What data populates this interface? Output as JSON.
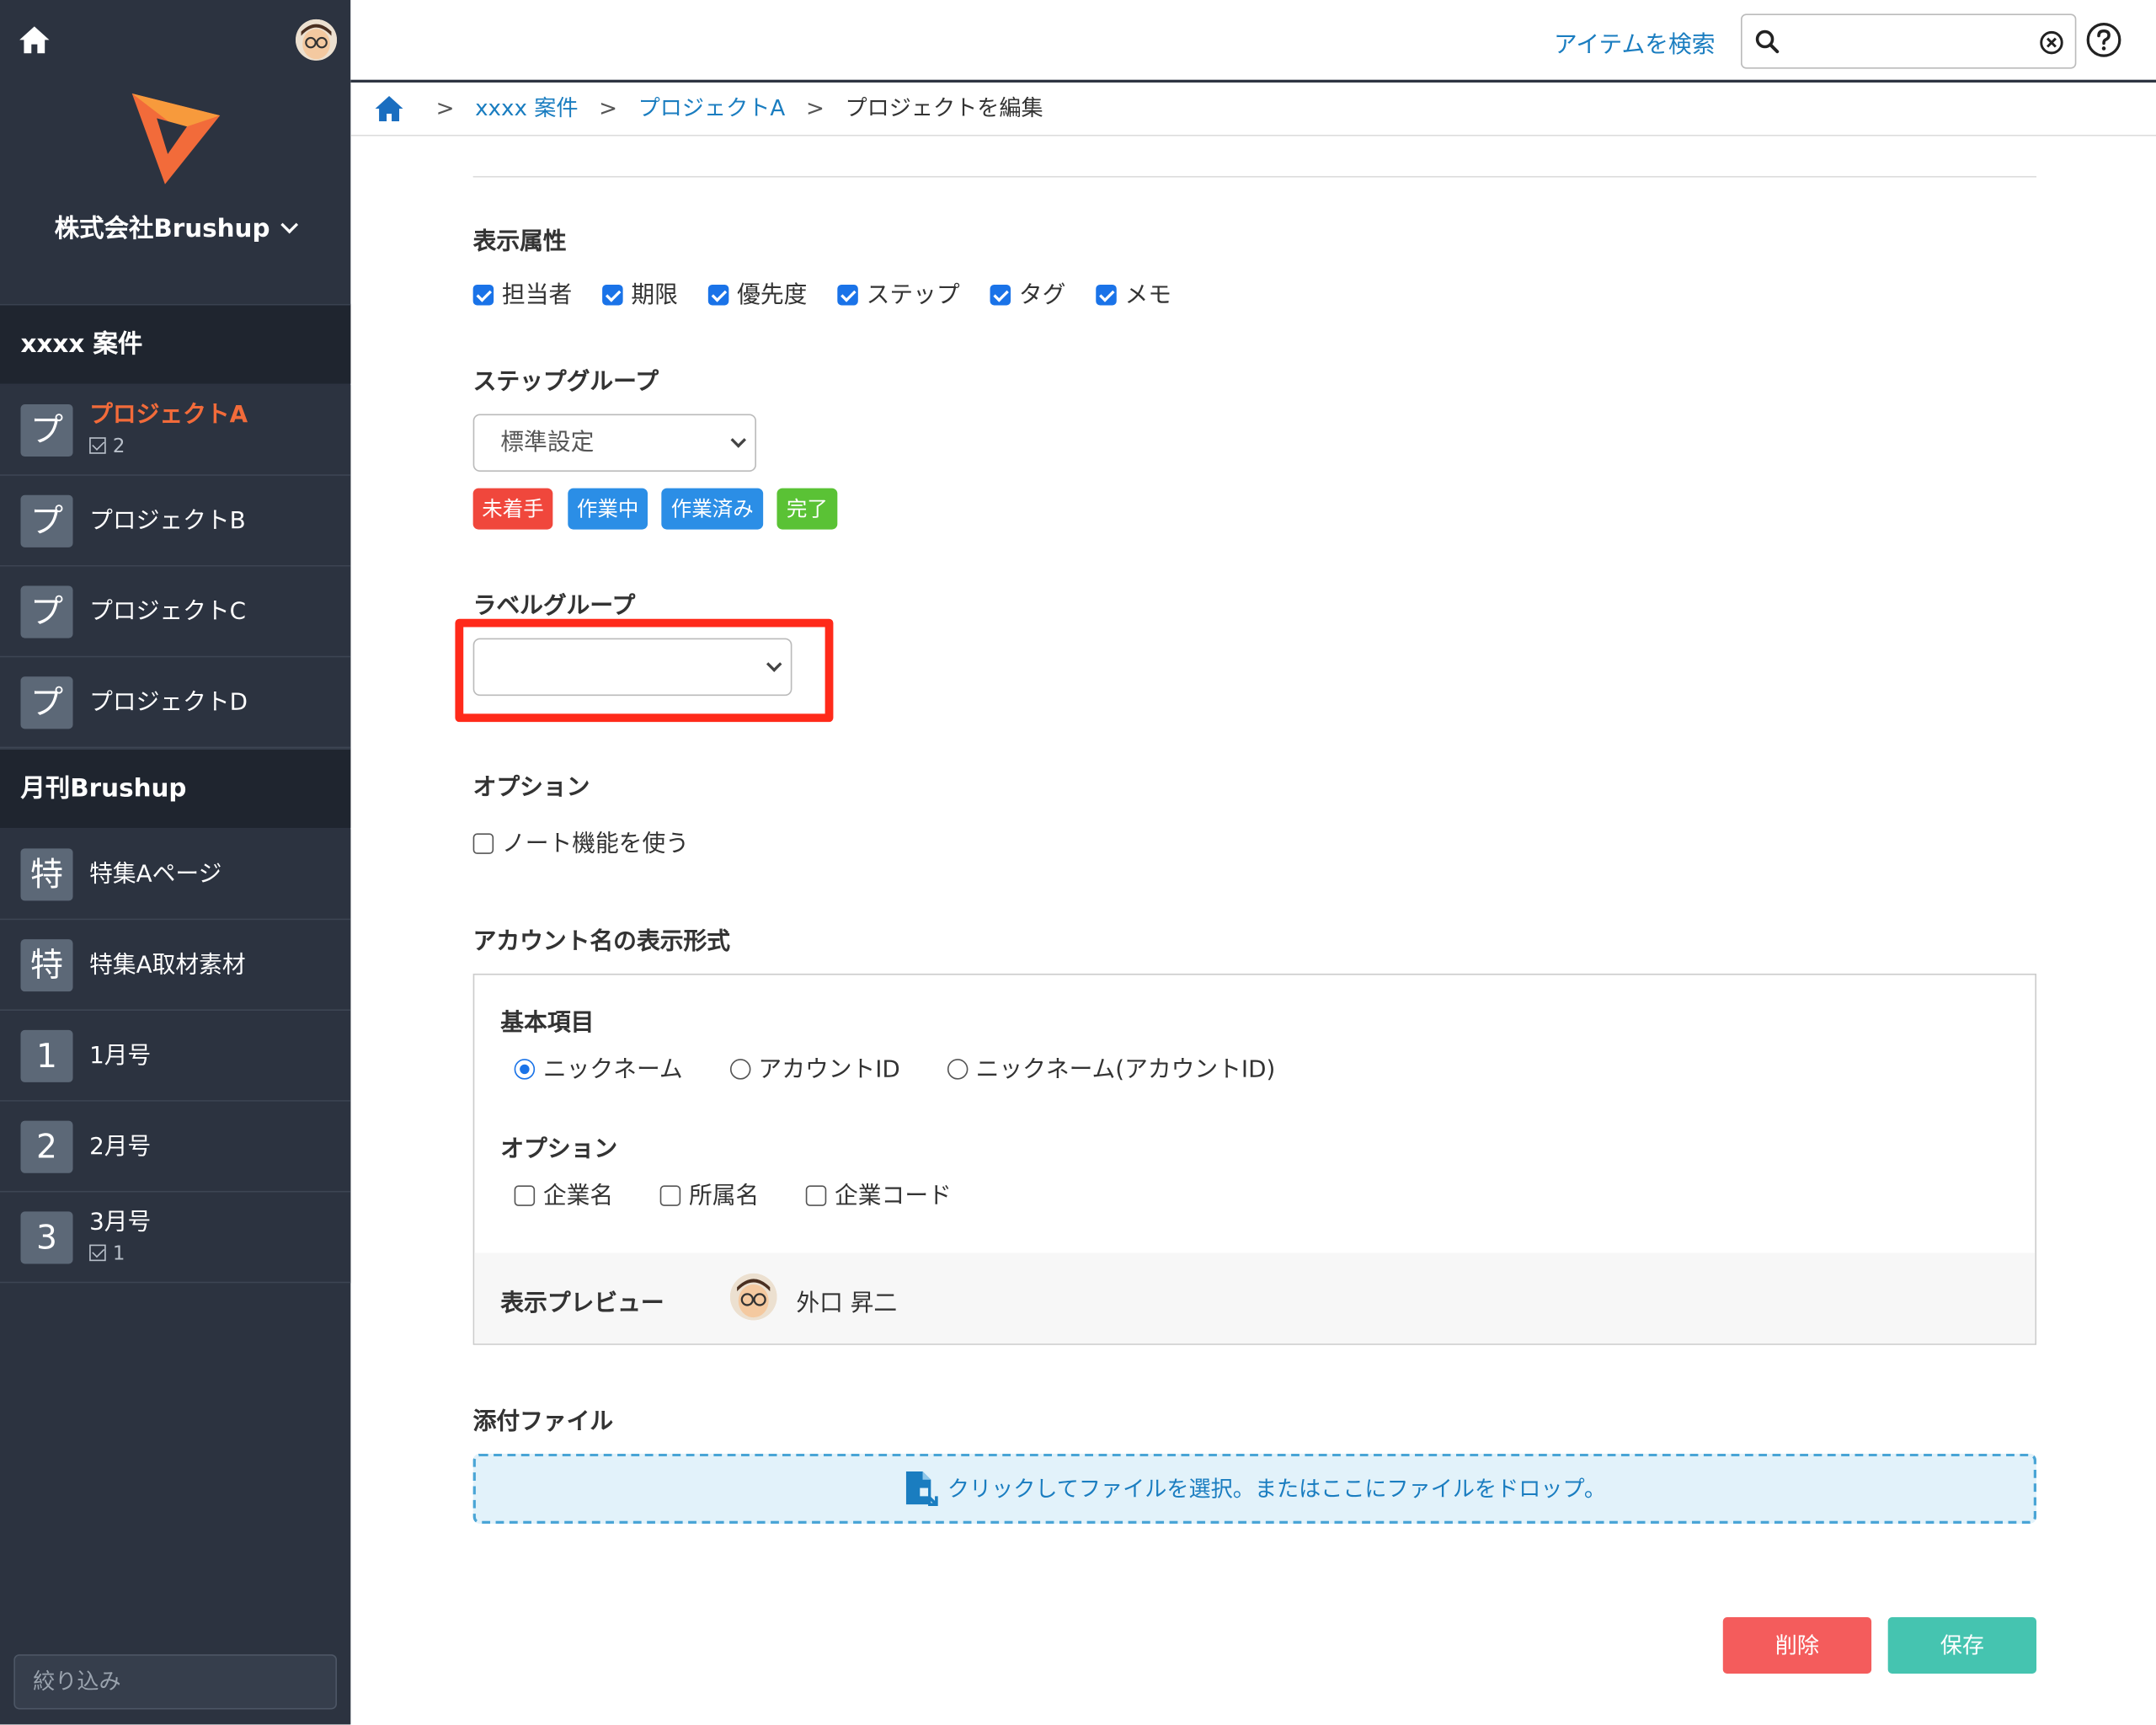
{
  "sidebar": {
    "company": "株式会社Brushup",
    "groups": [
      {
        "title": "xxxx 案件"
      },
      {
        "title": "月刊Brushup"
      }
    ],
    "items": [
      {
        "badge": "プ",
        "label": "プロジェクトA",
        "count": "2"
      },
      {
        "badge": "プ",
        "label": "プロジェクトB"
      },
      {
        "badge": "プ",
        "label": "プロジェクトC"
      },
      {
        "badge": "プ",
        "label": "プロジェクトD"
      },
      {
        "badge": "特",
        "label": "特集Aページ"
      },
      {
        "badge": "特",
        "label": "特集A取材素材"
      },
      {
        "badge": "1",
        "label": "1月号"
      },
      {
        "badge": "2",
        "label": "2月号"
      },
      {
        "badge": "3",
        "label": "3月号",
        "count": "1"
      }
    ],
    "filter_placeholder": "絞り込み"
  },
  "topbar": {
    "search_link": "アイテムを検索",
    "search_value": ""
  },
  "breadcrumb": {
    "items": [
      "xxxx 案件",
      "プロジェクトA",
      "プロジェクトを編集"
    ]
  },
  "form": {
    "display_attrs": {
      "title": "表示属性",
      "options": [
        {
          "label": "担当者",
          "checked": true
        },
        {
          "label": "期限",
          "checked": true
        },
        {
          "label": "優先度",
          "checked": true
        },
        {
          "label": "ステップ",
          "checked": true
        },
        {
          "label": "タグ",
          "checked": true
        },
        {
          "label": "メモ",
          "checked": true
        }
      ]
    },
    "step_group": {
      "title": "ステップグループ",
      "selected": "標準設定",
      "tags": [
        {
          "label": "未着手",
          "color": "#f0473c"
        },
        {
          "label": "作業中",
          "color": "#2b8ee6"
        },
        {
          "label": "作業済み",
          "color": "#2b8ee6"
        },
        {
          "label": "完了",
          "color": "#5ac235"
        }
      ]
    },
    "label_group": {
      "title": "ラベルグループ",
      "selected": ""
    },
    "options": {
      "title": "オプション",
      "note_label": "ノート機能を使う"
    },
    "account_display": {
      "title": "アカウント名の表示形式",
      "basic_title": "基本項目",
      "radios": [
        {
          "label": "ニックネーム",
          "checked": true
        },
        {
          "label": "アカウントID",
          "checked": false
        },
        {
          "label": "ニックネーム(アカウントID)",
          "checked": false
        }
      ],
      "options_title": "オプション",
      "checks": [
        {
          "label": "企業名",
          "checked": false
        },
        {
          "label": "所属名",
          "checked": false
        },
        {
          "label": "企業コード",
          "checked": false
        }
      ],
      "preview_label": "表示プレビュー",
      "preview_name": "外口 昇二"
    },
    "attachments": {
      "title": "添付ファイル",
      "drop_text": "クリックしてファイルを選択。またはここにファイルをドロップ。"
    },
    "delete_label": "削除",
    "save_label": "保存"
  },
  "colors": {
    "sidebar_bg": "#2c3340",
    "accent_orange": "#f26b3a",
    "link_blue": "#1a7dc0",
    "delete": "#f45c5c",
    "save": "#45c4b0",
    "highlight": "#ff2a1a"
  }
}
